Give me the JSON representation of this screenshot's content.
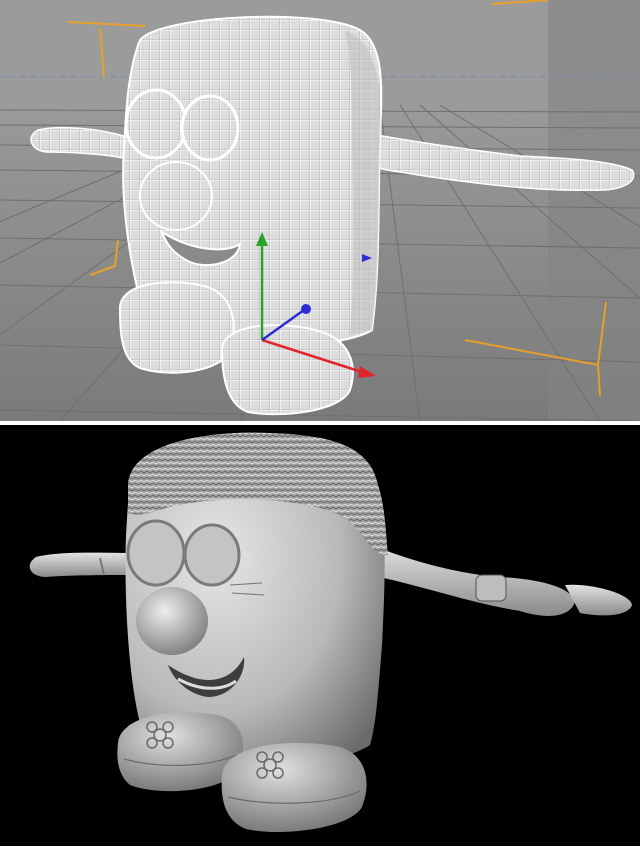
{
  "app": {
    "window_title": ""
  },
  "viewport": {
    "mode": "wireframe-perspective",
    "background_color": "#8d8d8d",
    "grid_color": "#6f6f6f",
    "wire_color": "#ffffff",
    "bracket_color": "#e7a02a"
  },
  "gizmo": {
    "x_axis_color": "#e0262a",
    "y_axis_color": "#2aa12a",
    "z_axis_color": "#2c2cd4"
  },
  "render": {
    "mode": "shaded-render",
    "background_color": "#000000",
    "surface_color": "#c8c8c8"
  },
  "icons": {
    "model": "character-mesh-icon",
    "gizmo": "move-gizmo-icon",
    "flower": "flower-emboss-icon"
  }
}
